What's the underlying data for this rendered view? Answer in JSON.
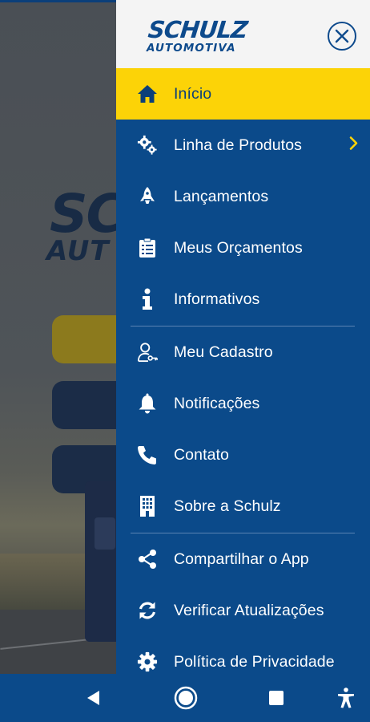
{
  "brand": {
    "line1": "SCHULZ",
    "line2": "AUTOMOTIVA"
  },
  "background": {
    "logo_main": "SC",
    "logo_sub": "AUT"
  },
  "menu": {
    "items": [
      {
        "label": "Início",
        "icon": "home-icon",
        "active": true
      },
      {
        "label": "Linha de Produtos",
        "icon": "gears-icon",
        "has_submenu": true
      },
      {
        "label": "Lançamentos",
        "icon": "rocket-icon"
      },
      {
        "label": "Meus Orçamentos",
        "icon": "clipboard-icon"
      },
      {
        "label": "Informativos",
        "icon": "info-icon"
      },
      {
        "label": "Meu Cadastro",
        "icon": "user-key-icon"
      },
      {
        "label": "Notificações",
        "icon": "bell-icon"
      },
      {
        "label": "Contato",
        "icon": "phone-icon"
      },
      {
        "label": "Sobre a Schulz",
        "icon": "building-icon"
      },
      {
        "label": "Compartilhar o App",
        "icon": "share-icon"
      },
      {
        "label": "Verificar Atualizações",
        "icon": "refresh-icon"
      },
      {
        "label": "Política de Privacidade",
        "icon": "gear-icon"
      }
    ]
  },
  "navbar": {
    "buttons": [
      "back-icon",
      "home-circle-icon",
      "recents-icon",
      "accessibility-icon"
    ]
  },
  "colors": {
    "primary": "#0b4a8a",
    "accent": "#fcd307",
    "header_bg": "#f4f4f4",
    "text_on_primary": "#ffffff"
  }
}
